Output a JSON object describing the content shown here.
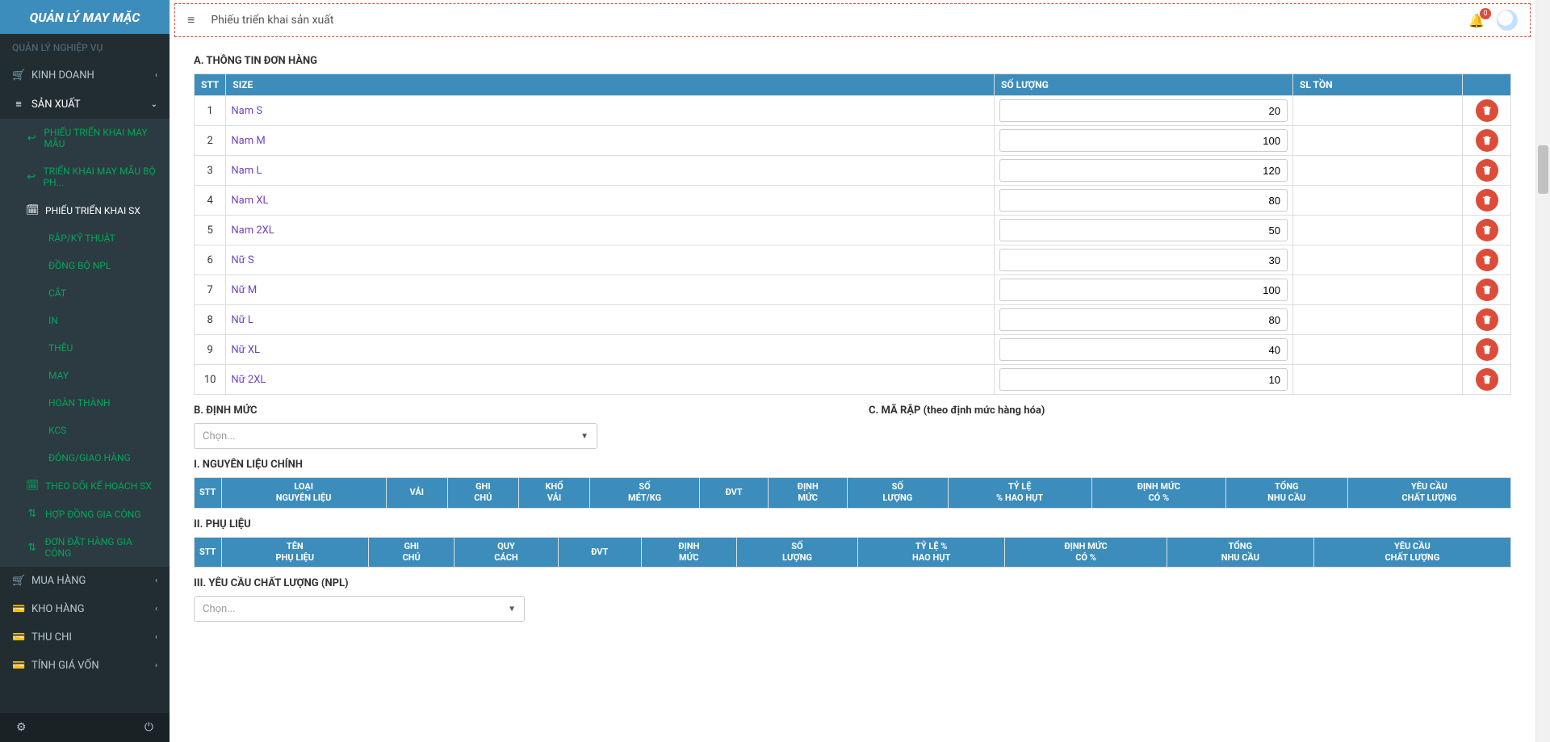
{
  "brand": "QUẢN LÝ MAY MẶC",
  "sidebar": {
    "section_header": "QUẢN LÝ NGHIỆP VỤ",
    "items": [
      {
        "icon": "🛒",
        "label": "KINH DOANH",
        "arrow": "‹"
      },
      {
        "icon": "≡",
        "label": "SẢN XUẤT",
        "arrow": "⌄",
        "expanded": true,
        "children": [
          {
            "icon": "↩",
            "label": "PHIẾU TRIỂN KHAI MAY MẪU"
          },
          {
            "icon": "↩",
            "label": "TRIỂN KHAI MAY MẪU BỘ PH..."
          },
          {
            "icon": "🗓",
            "label": "PHIẾU TRIỂN KHAI SX",
            "active": true,
            "children": [
              {
                "label": "RẬP/KỸ THUẬT"
              },
              {
                "label": "ĐỒNG BỘ NPL"
              },
              {
                "label": "CẮT"
              },
              {
                "label": "IN"
              },
              {
                "label": "THÊU"
              },
              {
                "label": "MAY"
              },
              {
                "label": "HOÀN THÀNH"
              },
              {
                "label": "KCS"
              },
              {
                "label": "ĐÓNG/GIAO HÀNG"
              }
            ]
          },
          {
            "icon": "🗓",
            "label": "THEO DÕI KẾ HOẠCH SX"
          },
          {
            "icon": "⇅",
            "label": "HỢP ĐỒNG GIA CÔNG"
          },
          {
            "icon": "⇅",
            "label": "ĐƠN ĐẶT HÀNG GIA CÔNG"
          }
        ]
      },
      {
        "icon": "🛒",
        "label": "MUA HÀNG",
        "arrow": "‹"
      },
      {
        "icon": "💳",
        "label": "KHO HÀNG",
        "arrow": "‹"
      },
      {
        "icon": "💳",
        "label": "THU CHI",
        "arrow": "‹"
      },
      {
        "icon": "💳",
        "label": "TÍNH GIÁ VỐN",
        "arrow": "‹"
      }
    ]
  },
  "topbar": {
    "title": "Phiếu triển khai sản xuất",
    "badge": "0"
  },
  "sections": {
    "a_title": "A. THÔNG TIN ĐƠN HÀNG",
    "b_title": "B. ĐỊNH MỨC",
    "c_title": "C. MÃ RẬP (theo định mức hàng hóa)",
    "i_title": "I. NGUYÊN LIỆU CHÍNH",
    "ii_title": "II. PHỤ LIỆU",
    "iii_title": "III. YÊU CẦU CHẤT LƯỢNG (NPL)",
    "select_placeholder": "Chọn..."
  },
  "size_table": {
    "headers": {
      "stt": "STT",
      "size": "SIZE",
      "qty": "SỐ LƯỢNG",
      "stock": "SL TỒN"
    },
    "rows": [
      {
        "stt": "1",
        "size": "Nam S",
        "qty": "20"
      },
      {
        "stt": "2",
        "size": "Nam M",
        "qty": "100"
      },
      {
        "stt": "3",
        "size": "Nam L",
        "qty": "120"
      },
      {
        "stt": "4",
        "size": "Nam XL",
        "qty": "80"
      },
      {
        "stt": "5",
        "size": "Nam 2XL",
        "qty": "50"
      },
      {
        "stt": "6",
        "size": "Nữ S",
        "qty": "30"
      },
      {
        "stt": "7",
        "size": "Nữ M",
        "qty": "100"
      },
      {
        "stt": "8",
        "size": "Nữ L",
        "qty": "80"
      },
      {
        "stt": "9",
        "size": "Nữ XL",
        "qty": "40"
      },
      {
        "stt": "10",
        "size": "Nữ 2XL",
        "qty": "10"
      }
    ]
  },
  "material_headers": [
    "STT",
    "LOẠI\nNGUYÊN LIỆU",
    "VẢI",
    "GHI\nCHÚ",
    "KHỔ\nVẢI",
    "SỐ\nMÉT/KG",
    "ĐVT",
    "ĐỊNH\nMỨC",
    "SỐ\nLƯỢNG",
    "TỶ LỆ\n% HAO HỤT",
    "ĐỊNH MỨC\nCÓ %",
    "TỔNG\nNHU CẦU",
    "YÊU CẦU\nCHẤT LƯỢNG"
  ],
  "accessory_headers": [
    "STT",
    "TÊN\nPHỤ LIỆU",
    "GHI\nCHÚ",
    "QUY\nCÁCH",
    "ĐVT",
    "ĐỊNH\nMỨC",
    "SỐ\nLƯỢNG",
    "TỶ LỆ %\nHAO HỤT",
    "ĐỊNH MỨC\nCÓ %",
    "TỔNG\nNHU CẦU",
    "YÊU CẦU\nCHẤT LƯỢNG"
  ]
}
